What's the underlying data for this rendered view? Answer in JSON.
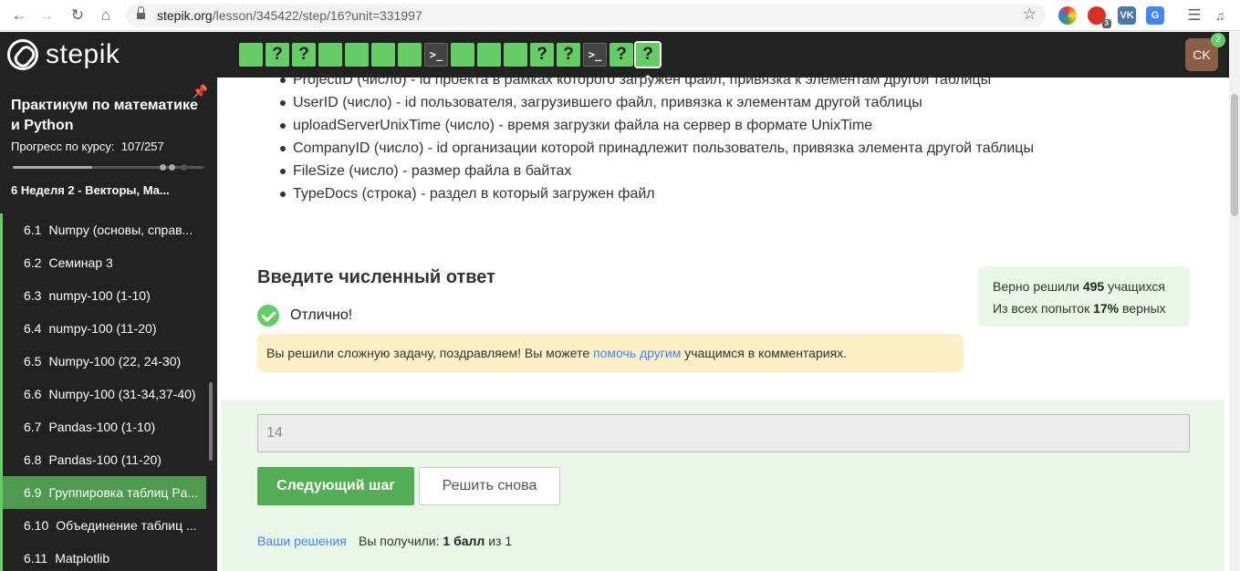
{
  "browser": {
    "url_host": "stepik.org",
    "url_path": "/lesson/345422/step/16?unit=331997",
    "extensions": [
      {
        "name": "color-wheel-icon",
        "label": "",
        "color": "#e3b505"
      },
      {
        "name": "opera-extension-icon",
        "label": "",
        "color": "#d93025",
        "badge": "3"
      },
      {
        "name": "vk-icon",
        "label": "VK",
        "color": "#4a76a8"
      },
      {
        "name": "translate-icon",
        "label": "G",
        "color": "#4285f4"
      }
    ]
  },
  "header": {
    "logo_text": "stepik",
    "steps": [
      {
        "type": "text",
        "label": "",
        "status": "passed"
      },
      {
        "type": "quiz",
        "label": "?",
        "status": "passed"
      },
      {
        "type": "quiz",
        "label": "?",
        "status": "passed"
      },
      {
        "type": "text",
        "label": "",
        "status": "passed"
      },
      {
        "type": "text",
        "label": "",
        "status": "passed"
      },
      {
        "type": "text",
        "label": "",
        "status": "passed"
      },
      {
        "type": "text",
        "label": "",
        "status": "passed"
      },
      {
        "type": "code",
        "label": ">_",
        "status": "not-passed"
      },
      {
        "type": "text",
        "label": "",
        "status": "passed"
      },
      {
        "type": "text",
        "label": "",
        "status": "passed"
      },
      {
        "type": "text",
        "label": "",
        "status": "passed"
      },
      {
        "type": "quiz",
        "label": "?",
        "status": "passed"
      },
      {
        "type": "quiz",
        "label": "?",
        "status": "passed"
      },
      {
        "type": "code",
        "label": ">_",
        "status": "not-passed"
      },
      {
        "type": "quiz",
        "label": "?",
        "status": "passed"
      },
      {
        "type": "quiz",
        "label": "?",
        "status": "current"
      }
    ],
    "avatar_initials": "CK",
    "notifications": "2"
  },
  "sidebar": {
    "course_title": "Практикум по математике и Python",
    "progress_label": "Прогресс по курсу:",
    "progress_value": "107/257",
    "progress_fraction": 0.416,
    "section_title": "6  Неделя 2 - Векторы, Ма...",
    "lessons": [
      {
        "num": "6.1",
        "title": "Numpy (основы, справ...",
        "active": false
      },
      {
        "num": "6.2",
        "title": "Семинар 3",
        "active": false
      },
      {
        "num": "6.3",
        "title": "numpy-100 (1-10)",
        "active": false
      },
      {
        "num": "6.4",
        "title": "numpy-100 (11-20)",
        "active": false
      },
      {
        "num": "6.5",
        "title": "Numpy-100 (22, 24-30)",
        "active": false
      },
      {
        "num": "6.6",
        "title": "Numpy-100 (31-34,37-40)",
        "active": false
      },
      {
        "num": "6.7",
        "title": "Pandas-100 (1-10)",
        "active": false
      },
      {
        "num": "6.8",
        "title": "Pandas-100 (11-20)",
        "active": false
      },
      {
        "num": "6.9",
        "title": "Группировка таблиц Pa...",
        "active": true
      },
      {
        "num": "6.10",
        "title": "Объединение таблиц ...",
        "active": false
      },
      {
        "num": "6.11",
        "title": "Matplotlib",
        "active": false
      }
    ]
  },
  "main": {
    "description_items": [
      "ProjectID (число) - id проекта в рамках которого загружен файл, привязка к элементам другой таблицы",
      "UserID (число) - id пользователя, загрузившего файл, привязка к элементам другой таблицы",
      "uploadServerUnixTime (число) - время загрузки файла на сервер в формате UnixTime",
      "CompanyID (число) - id организации которой принадлежит пользователь, привязка элемента другой таблицы",
      "FileSize (число) - размер файла в байтах",
      "TypeDocs (строка) - раздел в который загружен файл"
    ],
    "answer_heading": "Введите численный ответ",
    "success_text": "Отлично!",
    "hint": {
      "before": "Вы решили сложную задачу, поздравляем! Вы можете ",
      "link": "помочь другим",
      "after": " учащимся в комментариях."
    },
    "stats": {
      "solved_prefix": "Верно решили ",
      "solved_count": "495",
      "solved_suffix": " учащихся",
      "attempts_prefix": "Из всех попыток ",
      "attempts_percent": "17%",
      "attempts_suffix": " верных"
    },
    "answer_value": "14",
    "next_button": "Следующий шаг",
    "retry_button": "Решить снова",
    "your_solutions": "Ваши решения",
    "score_prefix": "Вы получили: ",
    "score_value": "1 балл",
    "score_suffix": " из 1"
  },
  "colors": {
    "accent_green": "#66cc66",
    "header_bg": "#222222",
    "link_blue": "#4285f4"
  }
}
